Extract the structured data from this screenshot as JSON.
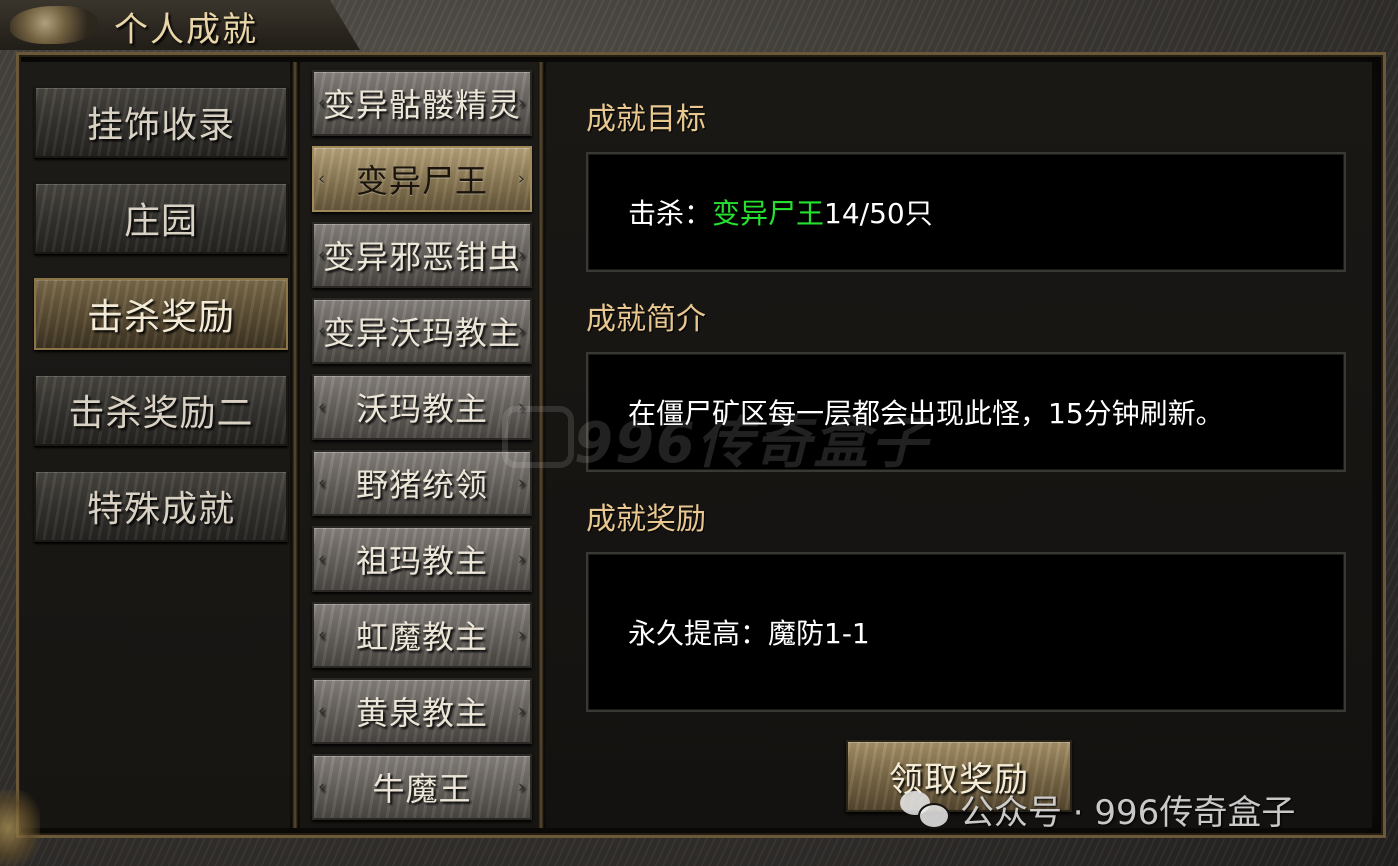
{
  "window": {
    "title": "个人成就"
  },
  "categories": [
    {
      "label": "挂饰收录",
      "active": false
    },
    {
      "label": "庄园",
      "active": false
    },
    {
      "label": "击杀奖励",
      "active": true
    },
    {
      "label": "击杀奖励二",
      "active": false
    },
    {
      "label": "特殊成就",
      "active": false
    }
  ],
  "sub_items": [
    {
      "label": "变异骷髅精灵",
      "active": false
    },
    {
      "label": "变异尸王",
      "active": true
    },
    {
      "label": "变异邪恶钳虫",
      "active": false
    },
    {
      "label": "变异沃玛教主",
      "active": false
    },
    {
      "label": "沃玛教主",
      "active": false
    },
    {
      "label": "野猪统领",
      "active": false
    },
    {
      "label": "祖玛教主",
      "active": false
    },
    {
      "label": "虹魔教主",
      "active": false
    },
    {
      "label": "黄泉教主",
      "active": false
    },
    {
      "label": "牛魔王",
      "active": false
    }
  ],
  "detail": {
    "goal_title": "成就目标",
    "goal_prefix": "击杀：",
    "goal_target": "变异尸王",
    "goal_progress": "14/50只",
    "intro_title": "成就简介",
    "intro_text": "在僵尸矿区每一层都会出现此怪，15分钟刷新。",
    "reward_title": "成就奖励",
    "reward_text": "永久提高：魔防1-1",
    "claim_label": "领取奖励"
  },
  "watermarks": {
    "center": "996传奇盒子",
    "bottom": "公众号 · 996传奇盒子"
  },
  "colors": {
    "highlight_green": "#25e02e",
    "section_gold": "#e8c890"
  }
}
